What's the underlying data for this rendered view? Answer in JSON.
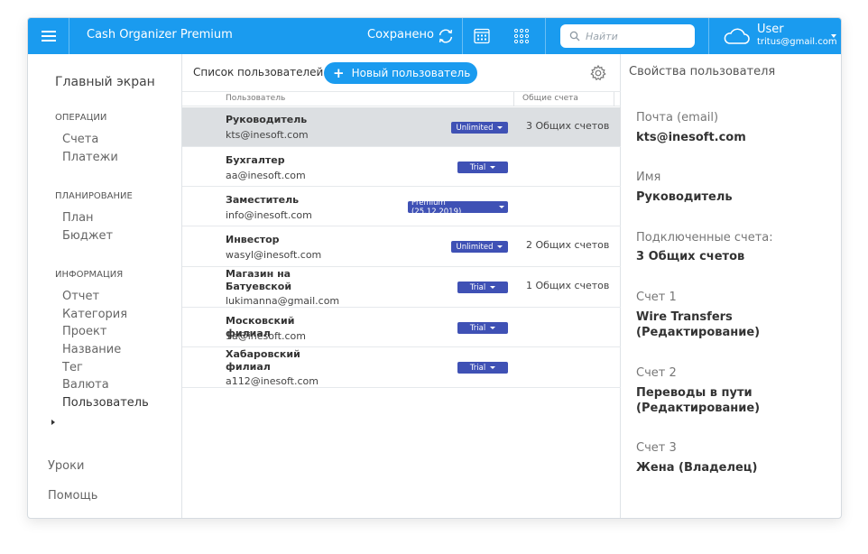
{
  "app": {
    "title": "Cash Organizer Premium",
    "saved": "Сохранено"
  },
  "search": {
    "placeholder": "Найти"
  },
  "user": {
    "name": "User",
    "email": "tritus@gmail.com"
  },
  "sidebar": {
    "home": "Главный экран",
    "sections": [
      {
        "title": "Операции",
        "items": [
          "Счета",
          "Платежи"
        ]
      },
      {
        "title": "Планирование",
        "items": [
          "План",
          "Бюджет"
        ]
      },
      {
        "title": "Информация",
        "items": [
          "Отчет",
          "Категория",
          "Проект",
          "Название",
          "Тег",
          "Валюта",
          "Пользователь"
        ]
      }
    ],
    "active_item": "Пользователь",
    "bottom": [
      "Уроки",
      "Помощь"
    ]
  },
  "list": {
    "title": "Список пользователей",
    "new_button": "Новый пользователь",
    "columns": [
      "Пользователь",
      "Общие счета"
    ],
    "rows": [
      {
        "name": "Руководитель",
        "email": "kts@inesoft.com",
        "plan": "Unlimited",
        "accounts": "3 Общих счетов",
        "selected": true
      },
      {
        "name": "Бухгалтер",
        "email": "aa@inesoft.com",
        "plan": "Trial",
        "accounts": ""
      },
      {
        "name": "Заместитель",
        "email": "info@inesoft.com",
        "plan": "Premium (25.12.2019)",
        "accounts": ""
      },
      {
        "name": "Инвестор",
        "email": "wasyl@inesoft.com",
        "plan": "Unlimited",
        "accounts": "2 Общих счетов"
      },
      {
        "name": "Магазин на Батуевской",
        "email": "lukimanna@gmail.com",
        "plan": "Trial",
        "accounts": "1 Общих счетов"
      },
      {
        "name": "Московский филиал",
        "email": "1a@inesoft.com",
        "plan": "Trial",
        "accounts": ""
      },
      {
        "name": "Хабаровский филиал",
        "email": "a112@inesoft.com",
        "plan": "Trial",
        "accounts": ""
      }
    ]
  },
  "properties": {
    "title": "Свойства пользователя",
    "fields": [
      {
        "label": "Почта (email)",
        "value": "kts@inesoft.com"
      },
      {
        "label": "Имя",
        "value": "Руководитель"
      },
      {
        "label": "Подключенные счета:",
        "value": "3 Общих счетов"
      },
      {
        "label": "Счет 1",
        "value": "Wire Transfers (Редактирование)"
      },
      {
        "label": "Счет 2",
        "value": "Переводы в пути (Редактирование)"
      },
      {
        "label": "Счет 3",
        "value": "Жена (Владелец)"
      }
    ]
  },
  "colors": {
    "accent": "#1a9bef",
    "badge": "#3f51b5",
    "selected_row": "#dcdfe2"
  }
}
